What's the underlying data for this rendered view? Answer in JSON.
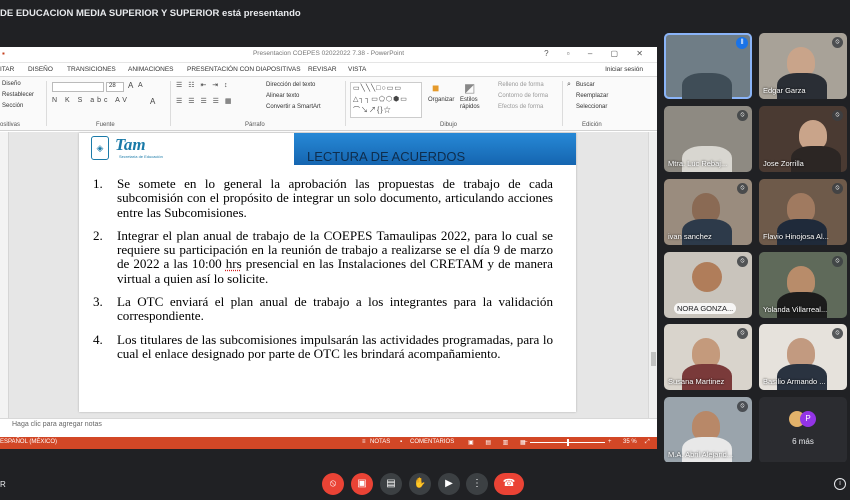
{
  "banner": "DE EDUCACION MEDIA SUPERIOR Y SUPERIOR está presentando",
  "ppt": {
    "window_title": "Presentacion COEPES 02022022 7.38 - PowerPoint",
    "tabs": [
      "ITAR",
      "DISEÑO",
      "TRANSICIONES",
      "ANIMACIONES",
      "PRESENTACIÓN CON DIAPOSITIVAS",
      "REVISAR",
      "VISTA"
    ],
    "sign_in": "Iniciar sesión",
    "ribbon": {
      "slides_items": [
        "Diseño",
        "Restablecer",
        "Sección"
      ],
      "slides_group": "ositivas",
      "font_size": "28",
      "font_group": "Fuente",
      "para_items": [
        "Dirección del texto",
        "Alinear texto",
        "Convertir a SmartArt"
      ],
      "para_group": "Párrafo",
      "arrange": "Organizar",
      "quick_styles": "Estilos rápidos",
      "fill_items": [
        "Relleno de forma",
        "Contorno de forma",
        "Efectos de forma"
      ],
      "draw_group": "Dibujo",
      "edit_items": [
        "Buscar",
        "Reemplazar",
        "Seleccionar"
      ],
      "edit_group": "Edición"
    },
    "slide": {
      "logo_text": "Tam",
      "logo_sub": "Secretaría de Educación",
      "title": "LECTURA DE ACUERDOS",
      "items": [
        {
          "num": "1.",
          "text": "Se somete en lo general la aprobación las propuestas de trabajo de cada subcomisión con el propósito de integrar un solo documento, articulando acciones entre las Subcomisiones."
        },
        {
          "num": "2.",
          "text_a": "Integrar el plan anual de trabajo de la COEPES Tamaulipas 2022, para lo cual se requiere su participación en la reunión de trabajo a realizarse se el día 9 de marzo de 2022 a las 10:00 ",
          "text_u": "hrs",
          "text_b": " presencial en las Instalaciones del CRETAM y de manera virtual a quien así lo solicite."
        },
        {
          "num": "3.",
          "text": "La OTC enviará el plan anual de trabajo a los integrantes para la validación correspondiente."
        },
        {
          "num": "4.",
          "text": "Los titulares de las subcomisiones impulsarán las actividades programadas, para lo cual el enlace designado por parte de OTC les brindará acompañamiento."
        }
      ]
    },
    "notes_placeholder": "Haga clic para agregar notas",
    "status": {
      "language": "ESPAÑOL (MÉXICO)",
      "notes": "NOTAS",
      "comments": "COMENTARIOS",
      "zoom": "35 %"
    }
  },
  "participants": [
    {
      "name": "",
      "state": "speaking"
    },
    {
      "name": "Edgar Garza"
    },
    {
      "name": "Mtra. Luc Rebaj..."
    },
    {
      "name": "Jose Zorrilla"
    },
    {
      "name": "ivan sanchez"
    },
    {
      "name": "Flavio Hinojosa Al..."
    },
    {
      "name": "NORA GONZA..."
    },
    {
      "name": "Yolanda Villarreal..."
    },
    {
      "name": "Susana Martinez"
    },
    {
      "name": "Basilio Armando ..."
    },
    {
      "name": "M.A. Abril Alejand..."
    },
    {
      "name": "6 más"
    }
  ],
  "more_avatar_initial": "P",
  "controls": {
    "left_label": "R",
    "mic_icon": "mic-off-icon",
    "cam_icon": "camera-off-icon",
    "cc_icon": "captions-icon",
    "hand_icon": "raise-hand-icon",
    "present_icon": "present-icon",
    "more_icon": "more-icon",
    "hangup_icon": "hangup-icon",
    "info_icon": "info-icon"
  },
  "colors": {
    "ppt_accent": "#d24726",
    "slide_title_bar": "#1f77c8",
    "meet_bg": "#202124",
    "danger": "#ea4335"
  }
}
